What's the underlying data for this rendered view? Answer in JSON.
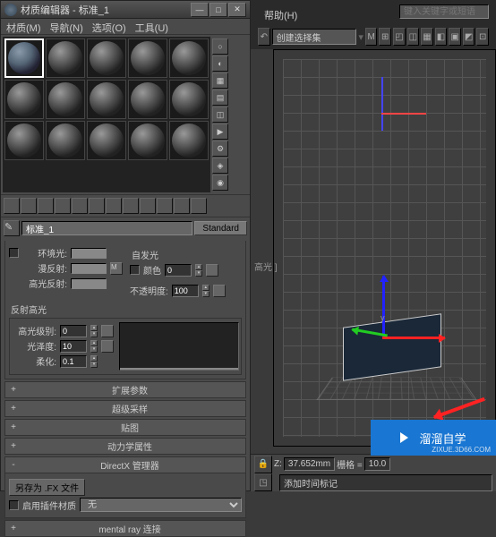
{
  "window": {
    "title": "材质编辑器 - 标准_1",
    "minimize": "—",
    "maximize": "□",
    "close": "✕"
  },
  "menubar": {
    "material": "材质(M)",
    "navigate": "导航(N)",
    "options": "选项(O)",
    "tools": "工具(U)"
  },
  "topmenu": {
    "help": "帮助(H)"
  },
  "top_search_placeholder": "键入关键字或短语",
  "selection_set": "创建选择集",
  "material_name": "标准_1",
  "material_type": "Standard",
  "params": {
    "ambient": "环境光:",
    "diffuse": "漫反射:",
    "specular": "高光反射:",
    "self_illum_header": "自发光",
    "color_cb": "颜色",
    "self_illum_value": "0",
    "opacity_label": "不透明度:",
    "opacity_value": "100",
    "highlights_group": "反射高光",
    "spec_level": "高光级别:",
    "spec_level_v": "0",
    "gloss": "光泽度:",
    "gloss_v": "10",
    "soften": "柔化:",
    "soften_v": "0.1",
    "map_m": "M"
  },
  "rollouts": {
    "extended": "扩展参数",
    "supersample": "超级采样",
    "maps": "贴图",
    "dynamics": "动力学属性",
    "directx": "DirectX 管理器",
    "mentalray": "mental ray 连接"
  },
  "dx": {
    "saveas": "另存为 .FX 文件",
    "enable_plugin": "启用插件材质",
    "none": "无"
  },
  "status": {
    "z_label": "Z:",
    "z_value": "37.652mm",
    "grid_label": "栅格 =",
    "grid_value": "10.0",
    "add_time_tag": "添加时间标记"
  },
  "right_panel_label": "高光 ]",
  "watermark": {
    "brand": "溜溜自学",
    "url": "ZIXUE.3D66.COM"
  }
}
